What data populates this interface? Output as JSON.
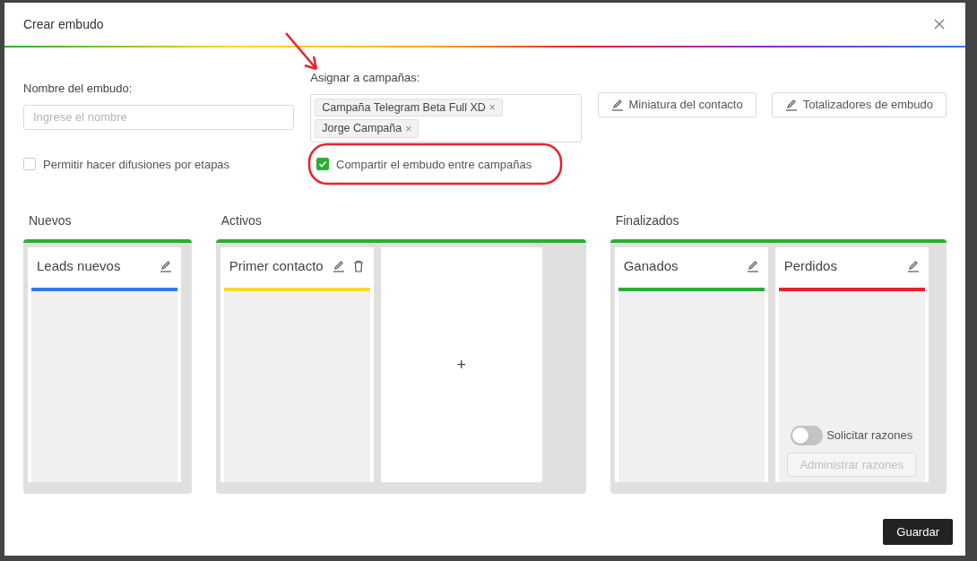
{
  "dialog": {
    "title": "Crear embudo"
  },
  "name_field": {
    "label": "Nombre del embudo:",
    "placeholder": "Ingrese el nombre"
  },
  "campaigns": {
    "label": "Asignar a campañas:",
    "tags": [
      {
        "label": "Campaña Telegram Beta Full XD",
        "remove": "×"
      },
      {
        "label": "Jorge Campaña",
        "remove": "×"
      }
    ]
  },
  "buttons": [
    {
      "label": "Miniatura del contacto"
    },
    {
      "label": "Totalizadores de embudo"
    }
  ],
  "options": [
    {
      "label": "Permitir hacer difusiones por etapas",
      "checked": false
    },
    {
      "label": "Compartir el embudo entre campañas",
      "checked": true
    }
  ],
  "groups": [
    {
      "title": "Nuevos",
      "stages": [
        {
          "kind": "stage",
          "name": "Leads nuevos",
          "color": "#2b7de9",
          "deletable": false
        }
      ]
    },
    {
      "title": "Activos",
      "stages": [
        {
          "kind": "stage",
          "name": "Primer contacto",
          "color": "#fcd92a",
          "deletable": true
        },
        {
          "kind": "add",
          "label": "+"
        }
      ]
    },
    {
      "title": "Finalizados",
      "stages": [
        {
          "kind": "stage",
          "name": "Ganados",
          "color": "#2aae35",
          "deletable": false
        },
        {
          "kind": "stage",
          "name": "Perdidos",
          "color": "#e8212a",
          "deletable": false,
          "reasons": {
            "toggle_label": "Solicitar razones",
            "on": false,
            "button": "Administrar razones"
          }
        }
      ]
    }
  ],
  "save": "Guardar"
}
